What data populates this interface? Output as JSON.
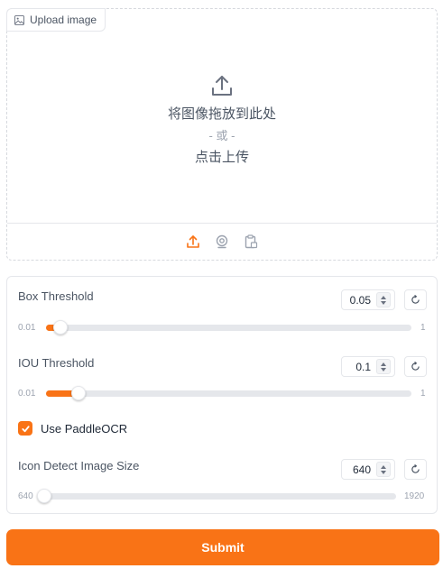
{
  "upload": {
    "tab_label": "Upload image",
    "drop_text": "将图像拖放到此处",
    "or_text": "- 或 -",
    "click_text": "点击上传",
    "source_icons": [
      "upload-icon",
      "webcam-icon",
      "clipboard-icon"
    ],
    "active_source": "upload-icon"
  },
  "settings": {
    "box_threshold": {
      "label": "Box Threshold",
      "value": "0.05",
      "min": "0.01",
      "max": "1",
      "fraction": 0.04
    },
    "iou_threshold": {
      "label": "IOU Threshold",
      "value": "0.1",
      "min": "0.01",
      "max": "1",
      "fraction": 0.09
    },
    "use_paddleocr": {
      "label": "Use PaddleOCR",
      "checked": true
    },
    "icon_size": {
      "label": "Icon Detect Image Size",
      "value": "640",
      "min": "640",
      "max": "1920",
      "fraction": 0.0
    }
  },
  "submit_label": "Submit",
  "colors": {
    "accent": "#f97316",
    "border": "#e5e7eb",
    "text": "#4b5563"
  }
}
